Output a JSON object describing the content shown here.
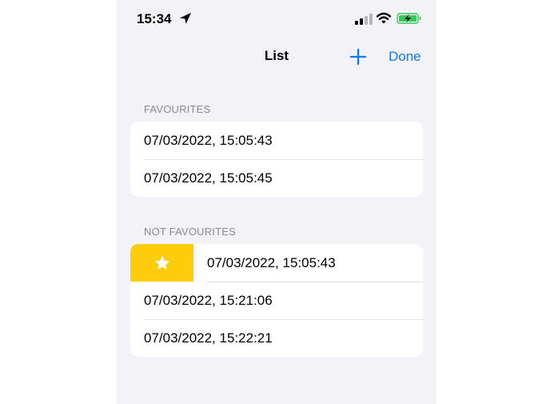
{
  "status_bar": {
    "time": "15:34",
    "icons": [
      "location-arrow-icon",
      "cellular-signal-icon",
      "wifi-icon",
      "battery-charging-icon"
    ]
  },
  "nav": {
    "title": "List",
    "add_icon": "plus-icon",
    "done_label": "Done"
  },
  "colors": {
    "accent": "#0a7aff",
    "favourite_action": "#fecc0a",
    "battery": "#34c759",
    "background": "#f2f2f7"
  },
  "favourites": {
    "header": "FAVOURITES",
    "items": [
      "07/03/2022, 15:05:43",
      "07/03/2022, 15:05:45"
    ]
  },
  "not_favourites": {
    "header": "NOT FAVOURITES",
    "swipe_action_icon": "star-icon",
    "items": [
      "07/03/2022, 15:05:43",
      "07/03/2022, 15:21:06",
      "07/03/2022, 15:22:21"
    ]
  }
}
